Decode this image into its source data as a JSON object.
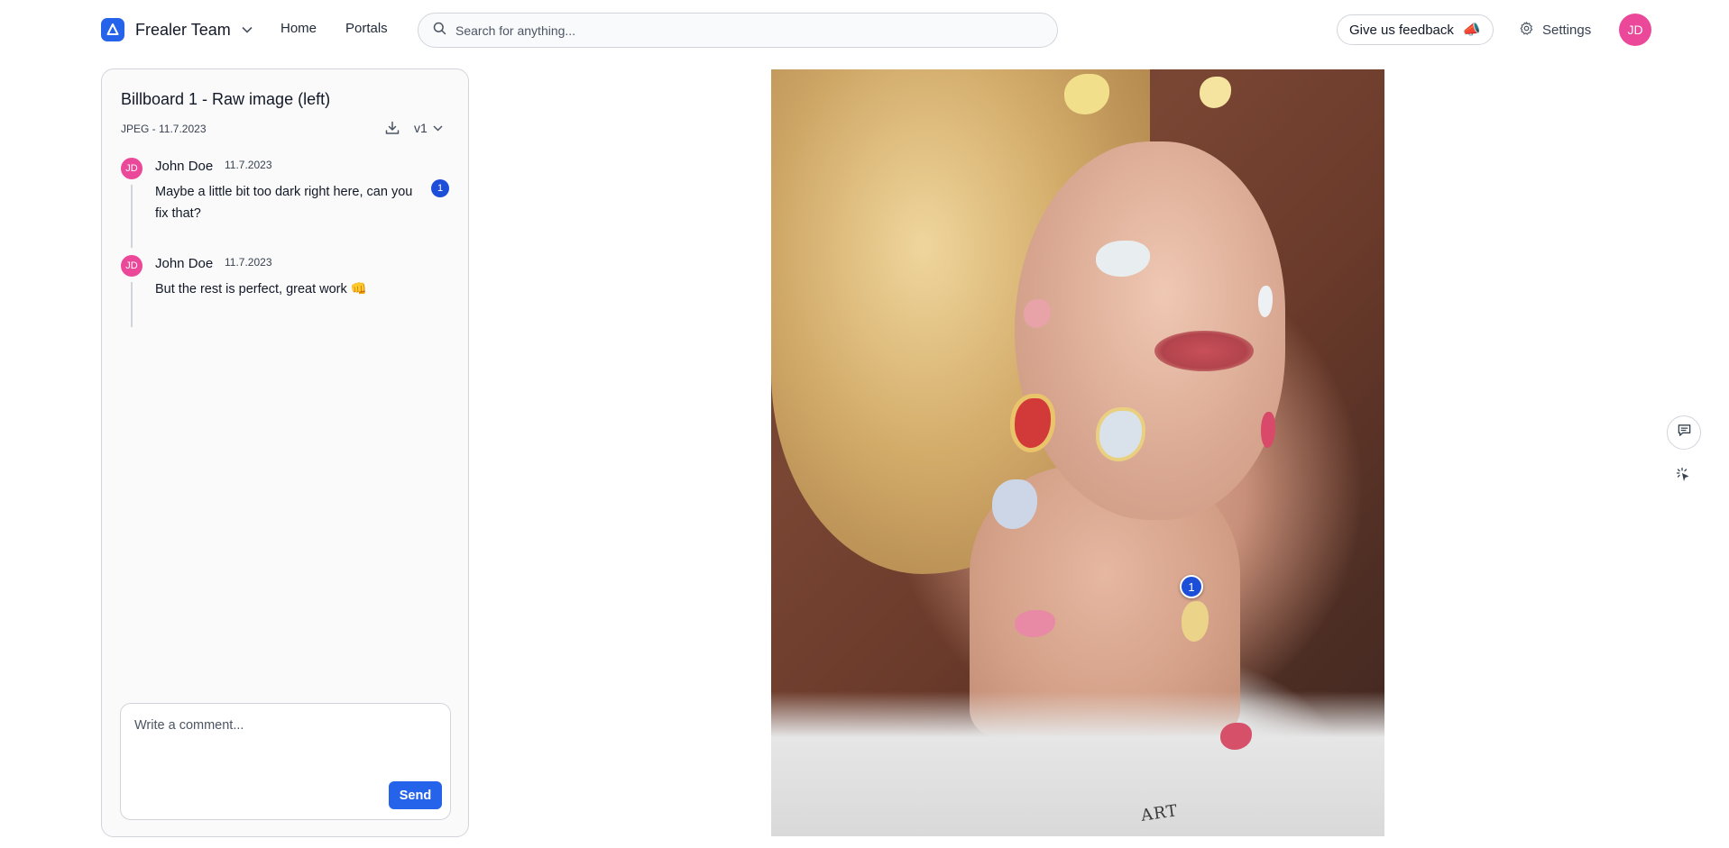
{
  "header": {
    "team_name": "Frealer Team",
    "nav": [
      "Home",
      "Portals"
    ],
    "search_placeholder": "Search for anything...",
    "feedback_label": "Give us feedback",
    "feedback_emoji": "📣",
    "settings_label": "Settings",
    "user_initials": "JD"
  },
  "asset": {
    "title": "Billboard 1 - Raw image (left)",
    "meta": "JPEG - 11.7.2023",
    "version": "v1"
  },
  "comments": [
    {
      "initials": "JD",
      "author": "John Doe",
      "date": "11.7.2023",
      "text": "Maybe a little bit too dark right here, can you fix that?",
      "pin": "1"
    },
    {
      "initials": "JD",
      "author": "John Doe",
      "date": "11.7.2023",
      "text": "But the rest is perfect, great work 👊"
    }
  ],
  "composer": {
    "placeholder": "Write a comment...",
    "send_label": "Send"
  },
  "viewer": {
    "marker_number": "1",
    "tattoo_text": "ART"
  },
  "colors": {
    "accent": "#2563eb",
    "avatar": "#ec4899"
  }
}
